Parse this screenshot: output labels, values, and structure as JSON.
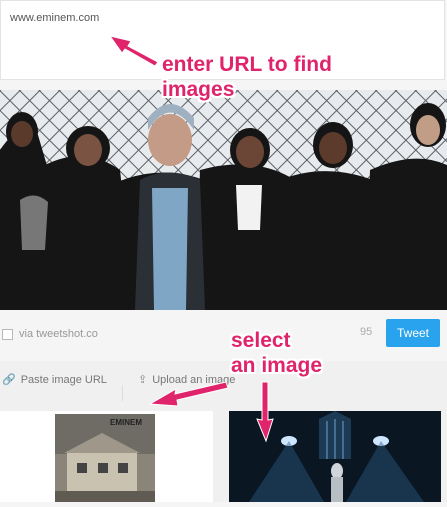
{
  "composer": {
    "text": "www.eminem.com"
  },
  "footer": {
    "via_label": "via tweetshot.co",
    "char_count": "95",
    "tweet_label": "Tweet"
  },
  "tools": {
    "paste_label": "Paste image URL",
    "upload_label": "Upload an image"
  },
  "thumb_album": {
    "brand_text": "EMINEM"
  },
  "annotations": {
    "enter_url_line1": "enter URL to find",
    "enter_url_line2": "images",
    "select_line1": "select",
    "select_line2": "an image"
  },
  "colors": {
    "tweet_button": "#2aa3ef",
    "annotation": "#e0246b"
  }
}
